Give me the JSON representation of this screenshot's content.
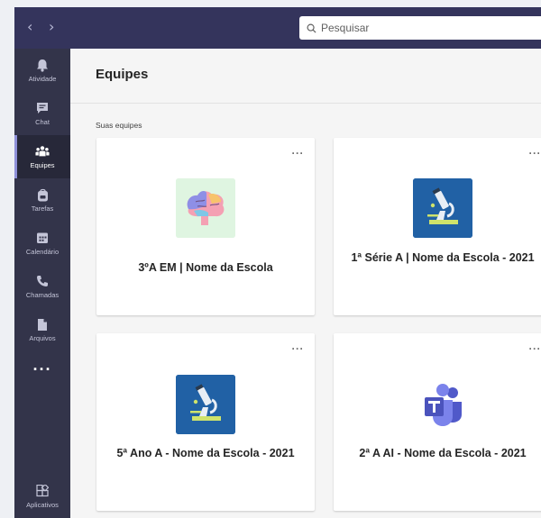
{
  "search": {
    "placeholder": "Pesquisar"
  },
  "sidebar": {
    "items": [
      {
        "label": "Atividade",
        "icon": "bell-icon"
      },
      {
        "label": "Chat",
        "icon": "chat-icon"
      },
      {
        "label": "Equipes",
        "icon": "teams-icon",
        "active": true
      },
      {
        "label": "Tarefas",
        "icon": "backpack-icon"
      },
      {
        "label": "Calendário",
        "icon": "calendar-icon"
      },
      {
        "label": "Chamadas",
        "icon": "phone-icon"
      },
      {
        "label": "Arquivos",
        "icon": "file-icon"
      }
    ],
    "more": "···",
    "apps_label": "Aplicativos"
  },
  "header": {
    "title": "Equipes"
  },
  "section": {
    "label": "Suas equipes"
  },
  "teams": [
    {
      "name": "3ºA EM | Nome da Escola",
      "image": "brain-image",
      "more": "···"
    },
    {
      "name": "1ª Série A | Nome da Escola - 2021",
      "image": "microscope-image",
      "more": "···"
    },
    {
      "name": "5ª Ano A - Nome da Escola - 2021",
      "image": "microscope-image",
      "more": "···"
    },
    {
      "name": "2ª A AI - Nome da Escola - 2021",
      "image": "teams-logo-image",
      "more": "···"
    }
  ],
  "colors": {
    "topbar": "#34345c",
    "sidebar": "#33344a",
    "accent": "#8e90d8"
  }
}
